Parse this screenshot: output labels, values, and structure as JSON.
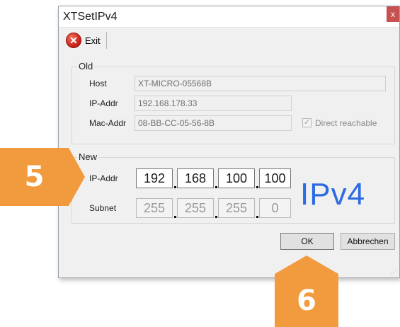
{
  "window": {
    "title": "XTSetIPv4",
    "close_glyph": "x"
  },
  "toolbar": {
    "exit_icon": "red-circle-x-icon",
    "exit_glyph": "✕",
    "exit_label": "Exit"
  },
  "old": {
    "group_label": "Old",
    "host_label": "Host",
    "host_value": "XT-MICRO-05568B",
    "ip_label": "IP-Addr",
    "ip_value": "192.168.178.33",
    "mac_label": "Mac-Addr",
    "mac_value": "08-BB-CC-05-56-8B",
    "direct_reachable_label": "Direct reachable",
    "direct_reachable_checked": true,
    "check_glyph": "✓"
  },
  "new": {
    "group_label": "New",
    "ip_label": "IP-Addr",
    "ip_octets": [
      "192",
      "168",
      "100",
      "100"
    ],
    "subnet_label": "Subnet",
    "subnet_octets": [
      "255",
      "255",
      "255",
      "0"
    ],
    "ipv4_text": "IPv4"
  },
  "buttons": {
    "ok_label": "OK",
    "cancel_label": "Abbrechen"
  },
  "callouts": {
    "step5": "5",
    "step6": "6",
    "color": "#f29b3e"
  },
  "colors": {
    "ipv4_text": "#2d6be0",
    "close_button": "#c75050"
  }
}
